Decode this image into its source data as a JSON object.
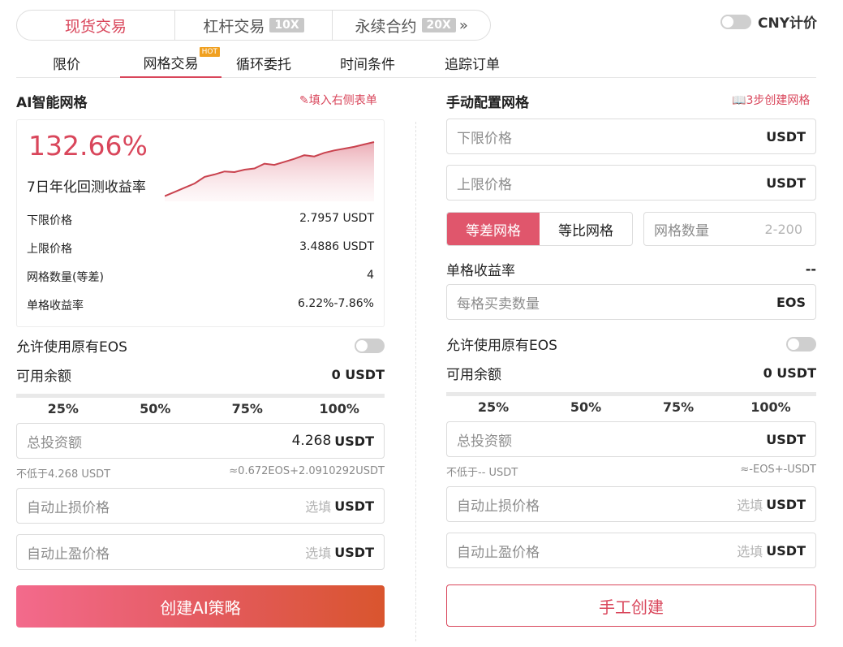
{
  "market_tabs": [
    {
      "label": "现货交易",
      "badge": ""
    },
    {
      "label": "杠杆交易",
      "badge": "10X"
    },
    {
      "label": "永续合约",
      "badge": "20X"
    }
  ],
  "cny_label": "CNY计价",
  "order_tabs": [
    {
      "label": "限价"
    },
    {
      "label": "网格交易",
      "badge": "HOT"
    },
    {
      "label": "循环委托"
    },
    {
      "label": "时间条件"
    },
    {
      "label": "追踪订单"
    }
  ],
  "ai": {
    "title": "AI智能网格",
    "fill_link": "填入右侧表单",
    "annual_rate": "132.66%",
    "annual_label": "7日年化回测收益率",
    "rows": [
      {
        "label": "下限价格",
        "value": "2.7957 USDT"
      },
      {
        "label": "上限价格",
        "value": "3.4886 USDT"
      },
      {
        "label": "网格数量(等差)",
        "value": "4"
      },
      {
        "label": "单格收益率",
        "value": "6.22%-7.86%"
      }
    ],
    "chart_trend": [
      0.06,
      0.13,
      0.2,
      0.27,
      0.38,
      0.42,
      0.47,
      0.46,
      0.5,
      0.52,
      0.6,
      0.58,
      0.63,
      0.68,
      0.74,
      0.72,
      0.78,
      0.82,
      0.85,
      0.88,
      0.92,
      0.96
    ],
    "allow_label": "允许使用原有EOS",
    "balance_label": "可用余额",
    "balance_value": "0 USDT",
    "percents": [
      "25%",
      "50%",
      "75%",
      "100%"
    ],
    "total_placeholder": "总投资额",
    "total_value": "4.268",
    "unit_usdt": "USDT",
    "min_note": "不低于4.268 USDT",
    "approx_note": "≈0.672EOS+2.0910292USDT",
    "stop_loss_placeholder": "自动止损价格",
    "take_profit_placeholder": "自动止盈价格",
    "optional": "选填",
    "create_button": "创建AI策略"
  },
  "manual": {
    "title": "手动配置网格",
    "guide_link": "3步创建网格",
    "lower_placeholder": "下限价格",
    "upper_placeholder": "上限价格",
    "unit_usdt": "USDT",
    "seg_arith": "等差网格",
    "seg_geo": "等比网格",
    "grid_count_placeholder": "网格数量",
    "grid_count_range": "2-200",
    "per_grid_label": "单格收益率",
    "per_grid_value": "--",
    "per_qty_placeholder": "每格买卖数量",
    "unit_eos": "EOS",
    "allow_label": "允许使用原有EOS",
    "balance_label": "可用余额",
    "balance_value": "0 USDT",
    "percents": [
      "25%",
      "50%",
      "75%",
      "100%"
    ],
    "total_placeholder": "总投资额",
    "min_note": "不低于-- USDT",
    "approx_note": "≈-EOS+-USDT",
    "stop_loss_placeholder": "自动止损价格",
    "take_profit_placeholder": "自动止盈价格",
    "optional": "选填",
    "create_button": "手工创建"
  }
}
